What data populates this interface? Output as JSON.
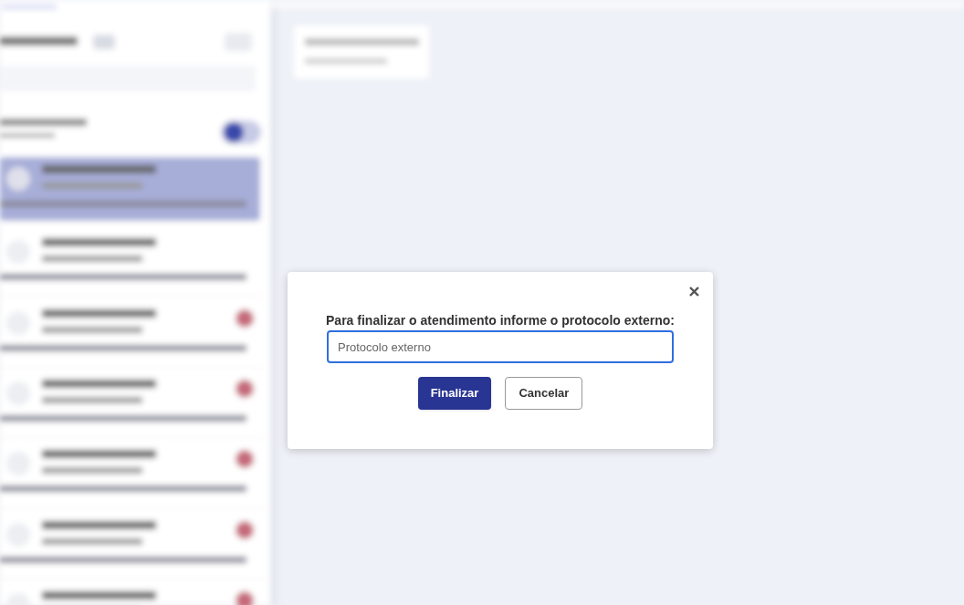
{
  "dialog": {
    "prompt": "Para finalizar o atendimento informe o protocolo externo:",
    "field": {
      "placeholder": "Protocolo externo",
      "focused": true
    },
    "buttons": [
      {
        "label": "Finalizar",
        "kind": "primary"
      },
      {
        "label": "Cancelar",
        "kind": "secondary"
      }
    ]
  }
}
